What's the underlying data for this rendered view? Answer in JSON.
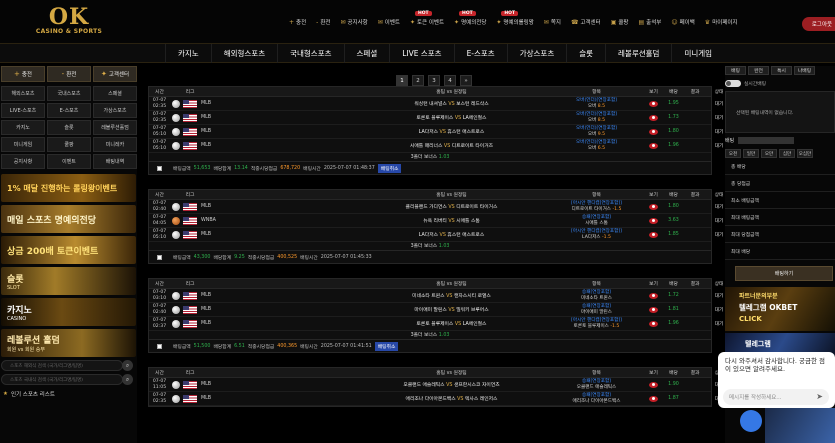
{
  "logo": {
    "big": "OK",
    "small": "CASINO & SPORTS"
  },
  "top_menu": [
    {
      "icon": "+",
      "label": "충전",
      "hot": ""
    },
    {
      "icon": "-",
      "label": "환전",
      "hot": ""
    },
    {
      "icon": "✉",
      "label": "공지사항",
      "hot": ""
    },
    {
      "icon": "✉",
      "label": "이벤트",
      "hot": ""
    },
    {
      "icon": "✦",
      "label": "토큰 이벤트",
      "hot": "HOT"
    },
    {
      "icon": "✦",
      "label": "명예의전당",
      "hot": "HOT"
    },
    {
      "icon": "✦",
      "label": "명예의롤링왕",
      "hot": "HOT"
    },
    {
      "icon": "✉",
      "label": "쪽지",
      "hot": ""
    },
    {
      "icon": "☎",
      "label": "고객센터",
      "hot": ""
    },
    {
      "icon": "▣",
      "label": "쿨팡",
      "hot": ""
    },
    {
      "icon": "▤",
      "label": "출석부",
      "hot": ""
    },
    {
      "icon": "☺",
      "label": "페이백",
      "hot": ""
    },
    {
      "icon": "♛",
      "label": "마이페이지",
      "hot": ""
    }
  ],
  "logout": "로그아웃",
  "nav": [
    "카지노",
    "해외형스포츠",
    "국내형스포츠",
    "스페셜",
    "LIVE 스포츠",
    "E-스포츠",
    "가상스포츠",
    "슬롯",
    "레볼루션홀덤",
    "미니게임"
  ],
  "left": {
    "actions": [
      {
        "icon": "+",
        "label": "충전"
      },
      {
        "icon": "-",
        "label": "환전"
      },
      {
        "icon": "✦",
        "label": "고객센터"
      }
    ],
    "cats": [
      "해외스포츠",
      "국내스포츠",
      "스페셜",
      "LIVE-스포츠",
      "E-스포츠",
      "가상스포츠",
      "카지노",
      "슬롯",
      "레볼루션홀덤",
      "미니게임",
      "쿨팡",
      "미니레카",
      "공지사항",
      "이벤트",
      "배팅내역"
    ],
    "banners": [
      {
        "title": "1% 매달 진행하는 롤링왕이벤트",
        "sub": ""
      },
      {
        "title": "매일 스포츠 명예의전당",
        "sub": ""
      },
      {
        "title": "상금 200배 토큰이벤트",
        "sub": ""
      },
      {
        "title": "슬롯",
        "sub": "SLOT"
      },
      {
        "title": "카지노",
        "sub": "CASINO"
      },
      {
        "title": "레볼루션 홀덤",
        "sub": "회원 vs 회원 승부"
      }
    ],
    "search1": "스포츠 해외식 검색 (국가/리그명/팀명)",
    "search2": "스포츠 국내식 검색 (국가/리그명/팀명)",
    "popular": "인기 스포츠 리스트"
  },
  "pager": [
    "1",
    "2",
    "3",
    "4",
    "»"
  ],
  "header_cols": [
    "시간",
    "",
    "리그",
    "",
    "홈팀 vs 원정팀",
    "항목",
    "보기",
    "배당",
    "결과",
    "상태"
  ],
  "blocks": [
    {
      "rows": [
        {
          "time": [
            "07-07",
            "02:35"
          ],
          "sport": "base",
          "league": "MLB",
          "home": "워싱턴 내셔널스",
          "away": "보스턴 레드삭스",
          "b1": "오버(언더)[연장포함]",
          "b2": "오버",
          "b3": "8.5",
          "odd": "1.95",
          "result": "",
          "status": "대기"
        },
        {
          "time": [
            "07-07",
            "02:35"
          ],
          "sport": "base",
          "league": "MLB",
          "home": "토론토 블루제이스",
          "away": "LA에인절스",
          "b1": "오버(언더)[연장포함]",
          "b2": "오버",
          "b3": "8.5",
          "odd": "1.73",
          "result": "",
          "status": "대기"
        },
        {
          "time": [
            "07-07",
            "05:10"
          ],
          "sport": "base",
          "league": "MLB",
          "home": "LA다저스",
          "away": "휴스턴 애스트로스",
          "b1": "오버(언더)[연장포함]",
          "b2": "오버",
          "b3": "9.5",
          "odd": "1.80",
          "result": "",
          "status": "대기"
        },
        {
          "time": [
            "07-07",
            "05:10"
          ],
          "sport": "base",
          "league": "MLB",
          "home": "시애틀 매리너스",
          "away": "디트로이트 타이거즈",
          "b1": "오버(언더)[연장포함]",
          "b2": "오버",
          "b3": "6.5",
          "odd": "1.96",
          "result": "",
          "status": "대기"
        }
      ],
      "bonus": [
        "3폴더 보너스",
        "1.03"
      ],
      "footer": {
        "amount_label": "배팅금액",
        "amount": "51,653",
        "odds_label": "배당합계",
        "odds": "13.14",
        "win_label": "적중시당첨금",
        "win": "678,720",
        "time_label": "배팅시간",
        "time": "2025-07-07 01:48:37",
        "cancel": "배팅취소"
      }
    },
    {
      "rows": [
        {
          "time": [
            "07-07",
            "02:40"
          ],
          "sport": "base",
          "league": "MLB",
          "home": "클리블랜드 가디언스",
          "away": "디트로이트 타이거스",
          "b1": "[아시안 핸디캡[연장포함]]",
          "b2": "디트로이트 타이거스",
          "b3": "-1.5",
          "odd": "1.80",
          "result": "",
          "status": "대기"
        },
        {
          "time": [
            "07-07",
            "04:05"
          ],
          "sport": "basket",
          "league": "WNBA",
          "home": "뉴욕 리버티",
          "away": "시애틀 스톰",
          "b1": "승패[연장포함]",
          "b2": "시애틀 스톰",
          "b3": "",
          "odd": "3.63",
          "result": "",
          "status": "대기"
        },
        {
          "time": [
            "07-07",
            "05:10"
          ],
          "sport": "base",
          "league": "MLB",
          "home": "LA다저스",
          "away": "휴스턴 애스트로스",
          "b1": "[아시안 핸디캡[연장포함]]",
          "b2": "LA다저스",
          "b3": "-1.5",
          "odd": "1.85",
          "result": "",
          "status": "대기"
        }
      ],
      "bonus": [
        "3폴더 보너스",
        "1.03"
      ],
      "footer": {
        "amount_label": "배팅금액",
        "amount": "43,300",
        "odds_label": "배당합계",
        "odds": "9.25",
        "win_label": "적중시당첨금",
        "win": "400,525",
        "time_label": "배팅시간",
        "time": "2025-07-07 01:45:33",
        "cancel": ""
      }
    },
    {
      "rows": [
        {
          "time": [
            "07-07",
            "03:10"
          ],
          "sport": "base",
          "league": "MLB",
          "home": "미네소타 트윈스",
          "away": "캔자스시티 로열스",
          "b1": "승패[연장포함]",
          "b2": "미네소타 트윈스",
          "b3": "",
          "odd": "1.72",
          "result": "",
          "status": "대기"
        },
        {
          "time": [
            "07-07",
            "02:40"
          ],
          "sport": "base",
          "league": "MLB",
          "home": "마이애미 말린스",
          "away": "밀워키 브루어스",
          "b1": "승패[연장포함]",
          "b2": "마이애미 말린스",
          "b3": "",
          "odd": "1.81",
          "result": "",
          "status": "대기"
        },
        {
          "time": [
            "07-07",
            "02:37"
          ],
          "sport": "base",
          "league": "MLB",
          "home": "토론토 블루제이스",
          "away": "LA에인절스",
          "b1": "[아시안 핸디캡[연장포함]]",
          "b2": "토론토 블루제이스",
          "b3": "-1.5",
          "odd": "1.96",
          "result": "",
          "status": "대기"
        }
      ],
      "bonus": [
        "3폴더 보너스",
        "1.03"
      ],
      "footer": {
        "amount_label": "배팅금액",
        "amount": "51,500",
        "odds_label": "배당합계",
        "odds": "6.51",
        "win_label": "적중시당첨금",
        "win": "400,365",
        "time_label": "배팅시간",
        "time": "2025-07-07 01:41:51",
        "cancel": "배팅취소"
      }
    },
    {
      "rows": [
        {
          "time": [
            "07-07",
            "11:05"
          ],
          "sport": "base",
          "league": "MLB",
          "home": "오클랜드 애슬레틱스",
          "away": "샌프란시스코 자이언츠",
          "b1": "승패[연장포함]",
          "b2": "오클랜드 애슬레틱스",
          "b3": "",
          "odd": "1.90",
          "result": "",
          "status": "대기"
        },
        {
          "time": [
            "07-07",
            "02:35"
          ],
          "sport": "base",
          "league": "MLB",
          "home": "애리조나 다이아몬드백스",
          "away": "텍사스 레인저스",
          "b1": "승패[연장포함]",
          "b2": "애리조나 다이아몬드백스",
          "b3": "",
          "odd": "1.87",
          "result": "",
          "status": "대기"
        }
      ],
      "bonus": [
        "",
        ""
      ],
      "footer": {
        "amount_label": "",
        "amount": "",
        "odds_label": "",
        "odds": "",
        "win_label": "",
        "win": "",
        "time_label": "",
        "time": "",
        "cancel": ""
      }
    }
  ],
  "right": {
    "tabs": [
      "배팅",
      "완전",
      "특시",
      "나배팅"
    ],
    "toggle": "실시간배팅",
    "empty": "선택된 배팅내역이 없습니다.",
    "bet_label": "배팅",
    "amounts": [
      "오천",
      "일만",
      "오만",
      "십만",
      "오십만"
    ],
    "kv": [
      "총 배당",
      "총 당첨금",
      "최소 배팅금액",
      "최대 배팅금액",
      "최대 당첨금액",
      "최대 배당"
    ],
    "bet_button": "배팅하기",
    "banner1": [
      "파트너문의부분",
      "텔레그램 OKBET",
      "CLICK"
    ],
    "banner2": "텔레그램"
  },
  "chat": {
    "message": "다시 와주셔서 감사합니다. 궁금한 점이 있으면 알려주세요.",
    "placeholder": "메시지를 작성하세요..."
  }
}
